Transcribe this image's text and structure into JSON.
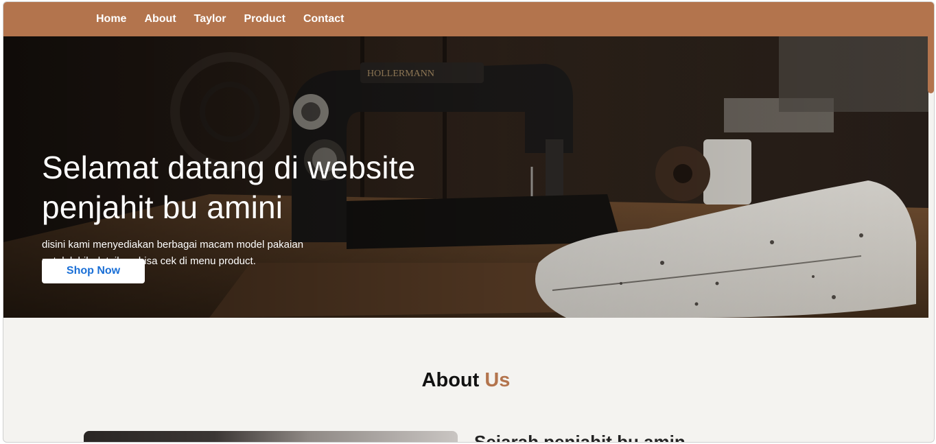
{
  "nav": {
    "items": [
      "Home",
      "About",
      "Taylor",
      "Product",
      "Contact"
    ]
  },
  "hero": {
    "title_line1": "Selamat datang di website",
    "title_line2": "penjahit bu amini",
    "subtitle_line1": "disini kami menyediakan berbagai macam model pakaian",
    "subtitle_line2": "untuk lebih detailnya bisa cek di menu product.",
    "button_label": "Shop Now",
    "background_icon": "sewing-machine-photo"
  },
  "about": {
    "title_main": "About",
    "title_accent": "Us",
    "history_heading": "Sejarah penjahit bu amin"
  },
  "colors": {
    "nav_bg": "#b3744d",
    "accent": "#b3744d",
    "button_text": "#1a6fd6",
    "section_bg": "#f4f3f0"
  }
}
